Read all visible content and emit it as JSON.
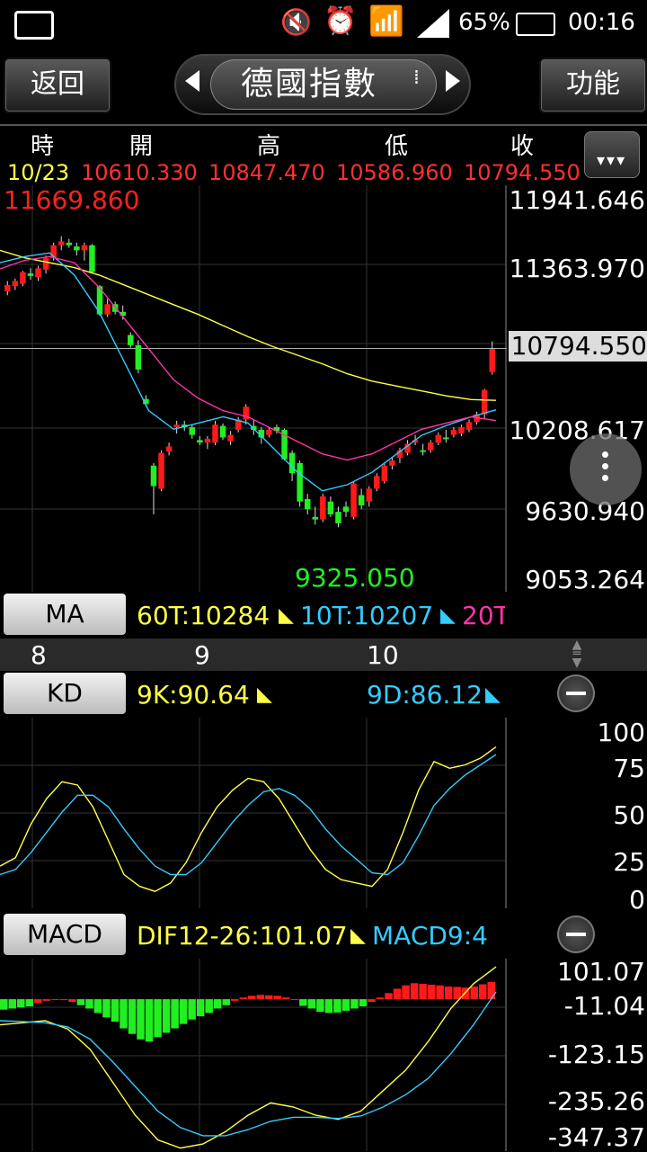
{
  "status_bar": {
    "battery": "65%",
    "time": "00:16"
  },
  "nav": {
    "back_label": "返回",
    "title": "德國指數",
    "func_label": "功能"
  },
  "ohlc": {
    "headers": [
      "時",
      "開",
      "高",
      "低",
      "收"
    ],
    "date": "10/23",
    "open": "10610.330",
    "high": "10847.470",
    "low": "10586.960",
    "close": "10794.550"
  },
  "main_chart": {
    "max_label": "11669.860",
    "min_label": "9325.050",
    "current_price": "10794.550",
    "y_ticks": [
      "11941.646",
      "11363.970",
      "10208.617",
      "9630.940",
      "9053.264"
    ],
    "x_ticks": [
      "8",
      "9",
      "10"
    ]
  },
  "ma_panel": {
    "button_label": "MA",
    "ma60": "60T:10284",
    "ma10": "10T:10207",
    "ma20": "20T"
  },
  "kd_panel": {
    "button_label": "KD",
    "k_value": "9K:90.64",
    "d_value": "9D:86.12",
    "y_ticks": [
      "100",
      "75",
      "50",
      "25",
      "0"
    ]
  },
  "macd_panel": {
    "button_label": "MACD",
    "dif_value": "DIF12-26:101.07",
    "macd_value": "MACD9:4",
    "y_ticks": [
      "101.07",
      "-11.04",
      "-123.15",
      "-235.26",
      "-347.37"
    ]
  },
  "colors": {
    "up": "#ff1a1a",
    "down": "#22ee22",
    "yellow": "#ffff44",
    "cyan": "#33ccff",
    "magenta": "#ff33aa"
  },
  "chart_data": [
    {
      "type": "candlestick",
      "y_range": [
        9053.264,
        11941.646
      ],
      "candles": [
        [
          11240,
          11320,
          11210,
          11290
        ],
        [
          11280,
          11340,
          11250,
          11320
        ],
        [
          11300,
          11400,
          11280,
          11390
        ],
        [
          11380,
          11420,
          11330,
          11360
        ],
        [
          11350,
          11440,
          11320,
          11420
        ],
        [
          11410,
          11520,
          11380,
          11500
        ],
        [
          11500,
          11620,
          11480,
          11600
        ],
        [
          11600,
          11670,
          11560,
          11630
        ],
        [
          11620,
          11650,
          11580,
          11600
        ],
        [
          11590,
          11620,
          11520,
          11560
        ],
        [
          11560,
          11620,
          11480,
          11600
        ],
        [
          11600,
          11610,
          11380,
          11390
        ],
        [
          11280,
          11290,
          11050,
          11060
        ],
        [
          11060,
          11180,
          11040,
          11140
        ],
        [
          11140,
          11160,
          11060,
          11080
        ],
        [
          11080,
          11130,
          11020,
          11050
        ],
        [
          10900,
          10920,
          10800,
          10820
        ],
        [
          10820,
          10860,
          10600,
          10630
        ],
        [
          10400,
          10430,
          10340,
          10360
        ],
        [
          9880,
          9900,
          9500,
          9720
        ],
        [
          9700,
          10000,
          9680,
          9980
        ],
        [
          9990,
          10060,
          9960,
          10030
        ],
        [
          10180,
          10230,
          10130,
          10200
        ],
        [
          10200,
          10230,
          10150,
          10180
        ],
        [
          10180,
          10200,
          10090,
          10120
        ],
        [
          10080,
          10110,
          10040,
          10060
        ],
        [
          10060,
          10110,
          10010,
          10090
        ],
        [
          10060,
          10230,
          10040,
          10200
        ],
        [
          10190,
          10210,
          10080,
          10100
        ],
        [
          10070,
          10150,
          10040,
          10120
        ],
        [
          10160,
          10260,
          10140,
          10240
        ],
        [
          10240,
          10360,
          10200,
          10340
        ],
        [
          10190,
          10240,
          10120,
          10160
        ],
        [
          10160,
          10180,
          10050,
          10100
        ],
        [
          10120,
          10180,
          10100,
          10160
        ],
        [
          10180,
          10200,
          10130,
          10150
        ],
        [
          10160,
          10170,
          9920,
          9930
        ],
        [
          9980,
          10000,
          9760,
          9820
        ],
        [
          9900,
          9920,
          9560,
          9600
        ],
        [
          9620,
          9660,
          9500,
          9540
        ],
        [
          9480,
          9560,
          9420,
          9460
        ],
        [
          9460,
          9660,
          9440,
          9640
        ],
        [
          9600,
          9640,
          9480,
          9500
        ],
        [
          9520,
          9560,
          9400,
          9430
        ],
        [
          9560,
          9600,
          9480,
          9520
        ],
        [
          9480,
          9760,
          9460,
          9740
        ],
        [
          9650,
          9700,
          9540,
          9570
        ],
        [
          9600,
          9720,
          9560,
          9700
        ],
        [
          9700,
          9820,
          9680,
          9800
        ],
        [
          9760,
          9900,
          9740,
          9880
        ],
        [
          9880,
          9940,
          9850,
          9920
        ],
        [
          9940,
          10020,
          9900,
          10000
        ],
        [
          9980,
          10080,
          9960,
          10050
        ],
        [
          10060,
          10120,
          10040,
          10080
        ],
        [
          10000,
          10050,
          9960,
          9990
        ],
        [
          10000,
          10080,
          9980,
          10060
        ],
        [
          10060,
          10140,
          10040,
          10120
        ],
        [
          10100,
          10160,
          10060,
          10090
        ],
        [
          10120,
          10180,
          10100,
          10160
        ],
        [
          10130,
          10200,
          10110,
          10180
        ],
        [
          10160,
          10240,
          10140,
          10220
        ],
        [
          10220,
          10300,
          10200,
          10280
        ],
        [
          10280,
          10480,
          10250,
          10470
        ],
        [
          10610,
          10850,
          10590,
          10790
        ]
      ]
    },
    {
      "type": "line",
      "series": [
        {
          "name": "60T",
          "values": [
            11500,
            11440,
            11400,
            11360,
            11300,
            11220,
            11140,
            11060,
            10980,
            10890,
            10800,
            10720,
            10650,
            10580,
            10500,
            10440,
            10400,
            10360,
            10320,
            10290,
            10284
          ]
        },
        {
          "name": "10T",
          "values": [
            11400,
            11450,
            11480,
            11300,
            11000,
            10600,
            10200,
            10050,
            10100,
            10150,
            10100,
            9900,
            9700,
            9550,
            9600,
            9700,
            9850,
            10000,
            10080,
            10150,
            10207
          ]
        },
        {
          "name": "20T",
          "values": [
            11350,
            11420,
            11450,
            11400,
            11200,
            10950,
            10700,
            10450,
            10300,
            10200,
            10150,
            10050,
            9950,
            9850,
            9800,
            9850,
            9950,
            10050,
            10100,
            10150,
            10120
          ]
        }
      ]
    },
    {
      "type": "line",
      "y_range": [
        0,
        100
      ],
      "series": [
        {
          "name": "9K",
          "values": [
            20,
            25,
            45,
            60,
            70,
            68,
            55,
            35,
            15,
            8,
            5,
            10,
            22,
            40,
            55,
            65,
            72,
            70,
            60,
            45,
            30,
            18,
            12,
            10,
            8,
            18,
            40,
            65,
            82,
            78,
            80,
            84,
            90.64
          ]
        },
        {
          "name": "9D",
          "values": [
            15,
            18,
            28,
            40,
            52,
            62,
            62,
            55,
            42,
            30,
            20,
            15,
            15,
            22,
            34,
            46,
            56,
            64,
            66,
            62,
            54,
            42,
            32,
            24,
            16,
            15,
            22,
            38,
            56,
            66,
            74,
            80,
            86.12
          ]
        }
      ]
    },
    {
      "type": "bar",
      "y_range": [
        -347.37,
        101.07
      ],
      "values": [
        -25,
        -20,
        -15,
        -10,
        5,
        15,
        20,
        18,
        10,
        -5,
        -20,
        -40,
        -60,
        -80,
        -110,
        -135,
        -160,
        -170,
        -150,
        -130,
        -110,
        -90,
        -70,
        -55,
        -40,
        -20,
        -5,
        15,
        30,
        38,
        42,
        40,
        38,
        30,
        20,
        -8,
        -20,
        -35,
        -40,
        -38,
        -30,
        -20,
        -10,
        10,
        30,
        50,
        70,
        85,
        95,
        92,
        88,
        85,
        80,
        78,
        75,
        80,
        90,
        101
      ],
      "series": [
        {
          "name": "DIF12-26",
          "values": [
            -40,
            -35,
            -30,
            -50,
            -100,
            -180,
            -260,
            -320,
            -340,
            -330,
            -300,
            -260,
            -230,
            -240,
            -260,
            -270,
            -250,
            -200,
            -150,
            -80,
            0,
            60,
            101.07
          ]
        },
        {
          "name": "MACD9",
          "values": [
            -30,
            -32,
            -35,
            -45,
            -75,
            -130,
            -190,
            -250,
            -290,
            -310,
            -310,
            -295,
            -275,
            -265,
            -265,
            -268,
            -262,
            -240,
            -210,
            -170,
            -110,
            -40,
            40
          ]
        }
      ]
    }
  ]
}
